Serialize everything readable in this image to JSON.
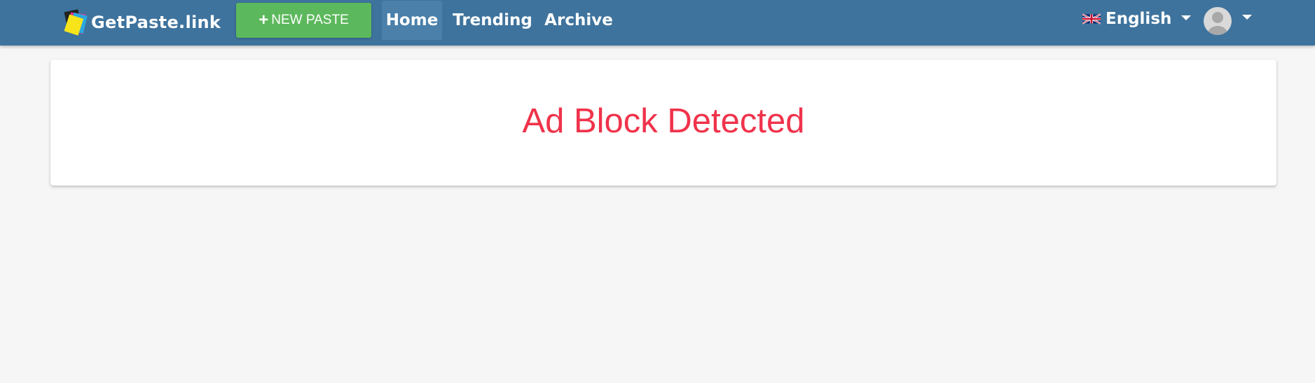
{
  "navbar": {
    "brand": {
      "name": "GetPaste.link",
      "logo_icon": "paste-logo-icon"
    },
    "new_paste": {
      "label": "NEW PASTE",
      "icon": "plus-icon"
    },
    "links": [
      {
        "label": "Home",
        "active": true
      },
      {
        "label": "Trending",
        "active": false
      },
      {
        "label": "Archive",
        "active": false
      }
    ],
    "language": {
      "label": "English",
      "flag_icon": "uk-flag-icon"
    },
    "user": {
      "avatar_icon": "user-avatar-icon"
    }
  },
  "main": {
    "message": "Ad Block Detected"
  },
  "colors": {
    "navbar_bg": "#3e739d",
    "new_paste_bg": "#5cb85c",
    "message": "#f0334b",
    "page_bg": "#f6f6f6"
  }
}
